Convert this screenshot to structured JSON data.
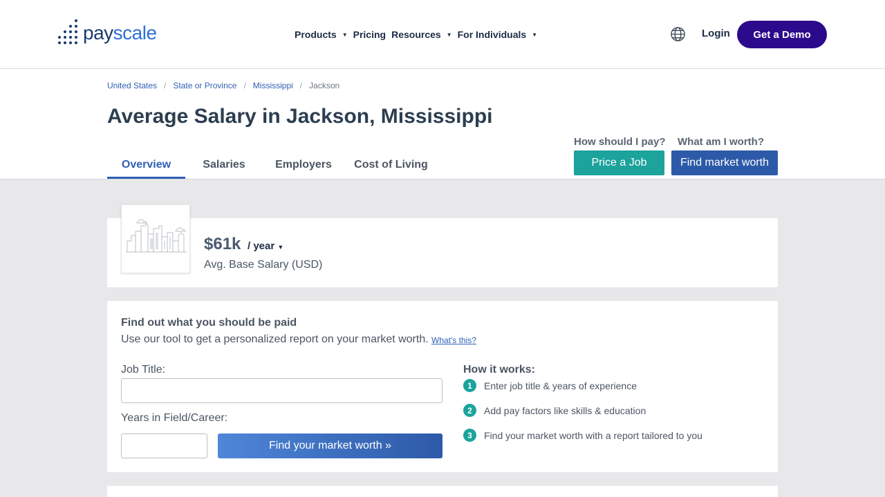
{
  "header": {
    "logo": {
      "part1": "pay",
      "part2": "scale"
    },
    "nav": [
      {
        "label": "Products",
        "has_caret": true
      },
      {
        "label": "Pricing",
        "has_caret": false
      },
      {
        "label": "Resources",
        "has_caret": true
      },
      {
        "label": "For Individuals",
        "has_caret": true
      }
    ],
    "globe_icon": "globe-icon",
    "login_label": "Login",
    "demo_label": "Get a Demo",
    "demo_color": "#2c0a8c"
  },
  "breadcrumb": [
    "United States",
    "State or Province",
    "Mississippi",
    "Jackson"
  ],
  "title": "Average Salary in Jackson, Mississippi",
  "tabs": [
    "Overview",
    "Salaries",
    "Employers",
    "Cost of Living"
  ],
  "active_tab": "Overview",
  "cta": {
    "q1": "How should I pay?",
    "price_label": "Price a Job",
    "q2": "What am I worth?",
    "worth_label": "Find market worth",
    "teal": "#1ba39c",
    "blue": "#2d5aa8"
  },
  "salary": {
    "amount": "$61k",
    "period": "/ year",
    "subtitle": "Avg. Base Salary (USD)"
  },
  "tool": {
    "heading": "Find out what you should be paid",
    "subheading": "Use our tool to get a personalized report on your market worth.",
    "whats_this": "What's this?",
    "job_label": "Job Title:",
    "job_value": "",
    "years_label": "Years in Field/Career:",
    "years_value": "",
    "button_label": "Find your market worth »",
    "how_heading": "How it works:",
    "steps": [
      {
        "num": "1",
        "text": "Enter job title & years of experience"
      },
      {
        "num": "2",
        "text": "Add pay factors like skills & education"
      },
      {
        "num": "3",
        "text": "Find your market worth with a report tailored to you"
      }
    ]
  }
}
